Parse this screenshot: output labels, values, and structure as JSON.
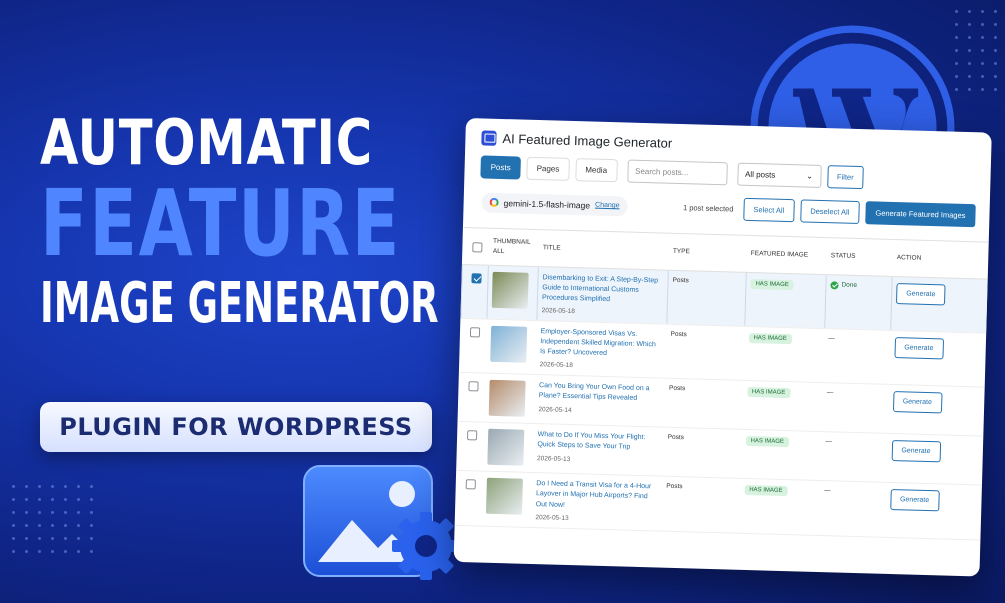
{
  "headline": {
    "line1": "AUTOMATIC",
    "line2": "FEATURE",
    "line3": "IMAGE GENERATOR",
    "pill": "PLUGIN FOR WORDPRESS"
  },
  "brand_colors": {
    "accent_blue": "#4f86ff",
    "wp_blue": "#2271b1",
    "background": "#1636b0"
  },
  "icons": [
    "wordpress-logo",
    "image-icon",
    "gear-icon",
    "google-gemini-icon"
  ],
  "plugin": {
    "title": "AI Featured Image Generator",
    "tabs": [
      {
        "label": "Posts",
        "active": true
      },
      {
        "label": "Pages",
        "active": false
      },
      {
        "label": "Media",
        "active": false
      }
    ],
    "search_placeholder": "Search posts...",
    "filter_select": "All posts",
    "filter_button": "Filter",
    "model_name": "gemini-1.5-flash-image",
    "change_link": "Change",
    "selected_count": "1 post selected",
    "select_all": "Select All",
    "deselect_all": "Deselect All",
    "generate_featured": "Generate Featured Images",
    "columns": {
      "thumbnail": "THUMBNAIL",
      "all": "ALL",
      "title": "TITLE",
      "type": "TYPE",
      "featured": "FEATURED IMAGE",
      "status": "STATUS",
      "action": "ACTION"
    },
    "rows": [
      {
        "checked": true,
        "title": "Disembarking to Exit: A Step-By-Step Guide to International Customs Procedures Simplified",
        "date": "2026-05-18",
        "type": "Posts",
        "featured": "HAS IMAGE",
        "status": "Done",
        "action": "Generate",
        "thumb": "#7a8a56"
      },
      {
        "checked": false,
        "title": "Employer-Sponsored Visas Vs. Independent Skilled Migration: Which Is Faster? Uncovered",
        "date": "2026-05-18",
        "type": "Posts",
        "featured": "HAS IMAGE",
        "status": "—",
        "action": "Generate",
        "thumb": "#7fb1d6"
      },
      {
        "checked": false,
        "title": "Can You Bring Your Own Food on a Plane? Essential Tips Revealed",
        "date": "2026-05-14",
        "type": "Posts",
        "featured": "HAS IMAGE",
        "status": "—",
        "action": "Generate",
        "thumb": "#b48b6a"
      },
      {
        "checked": false,
        "title": "What to Do If You Miss Your Flight: Quick Steps to Save Your Trip",
        "date": "2026-05-13",
        "type": "Posts",
        "featured": "HAS IMAGE",
        "status": "—",
        "action": "Generate",
        "thumb": "#9aa8b2"
      },
      {
        "checked": false,
        "title": "Do I Need a Transit Visa for a 4-Hour Layover in Major Hub Airports? Find Out Now!",
        "date": "2026-05-13",
        "type": "Posts",
        "featured": "HAS IMAGE",
        "status": "—",
        "action": "Generate",
        "thumb": "#8da27a"
      }
    ]
  }
}
